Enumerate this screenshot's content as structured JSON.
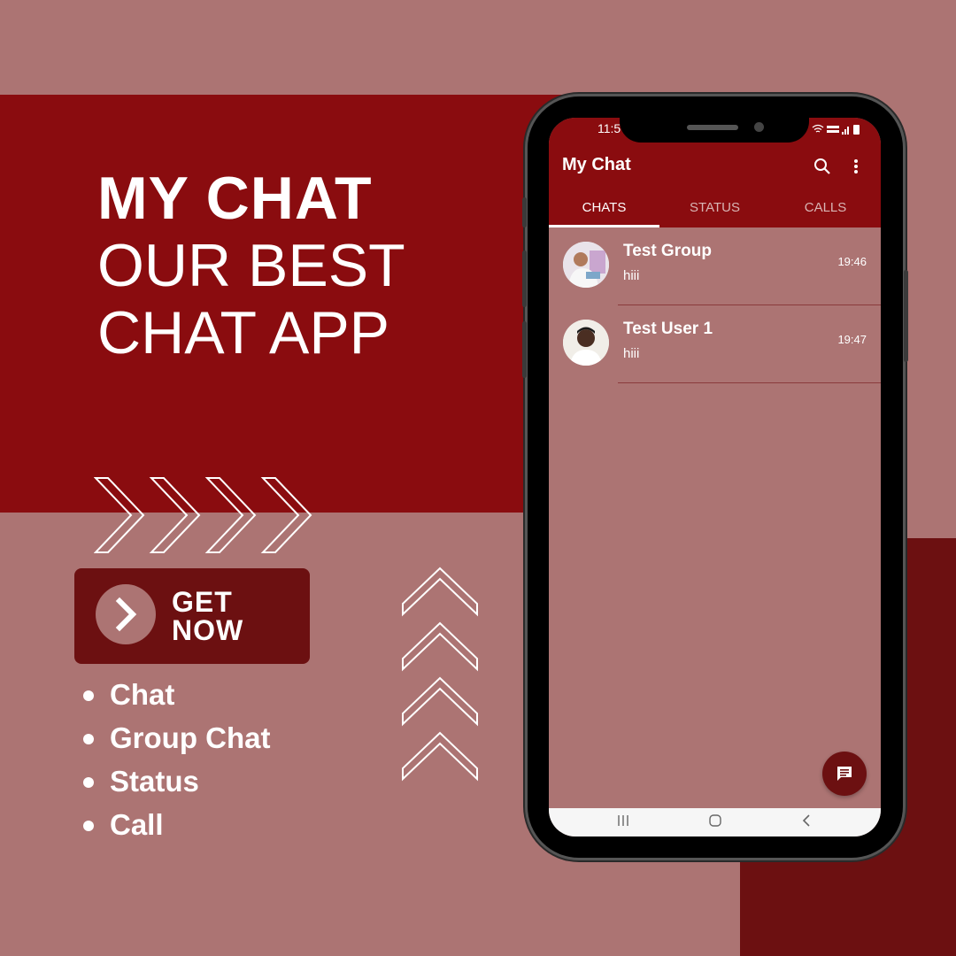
{
  "colors": {
    "background": "#ac7473",
    "brand_red": "#8a0c0f",
    "dark_red": "#6c1011",
    "white": "#ffffff"
  },
  "headline": {
    "line1": "MY CHAT",
    "line2": "OUR BEST",
    "line3": "CHAT APP"
  },
  "cta": {
    "label": "GET\nNOW",
    "icon": "chevron-right-icon"
  },
  "features": [
    "Chat",
    "Group Chat",
    "Status",
    "Call"
  ],
  "phone": {
    "status_bar": {
      "time": "11:5"
    },
    "app_title": "My Chat",
    "actions": [
      "search-icon",
      "more-vert-icon"
    ],
    "tabs": [
      {
        "label": "CHATS",
        "active": true
      },
      {
        "label": "STATUS",
        "active": false
      },
      {
        "label": "CALLS",
        "active": false
      }
    ],
    "chats": [
      {
        "name": "Test Group",
        "message": "hiii",
        "time": "19:46",
        "avatar": "group-avatar"
      },
      {
        "name": "Test User 1",
        "message": "hiii",
        "time": "19:47",
        "avatar": "user-avatar"
      }
    ],
    "fab_icon": "new-chat-icon",
    "nav_buttons": [
      "recent-apps-icon",
      "home-icon",
      "back-icon"
    ]
  }
}
